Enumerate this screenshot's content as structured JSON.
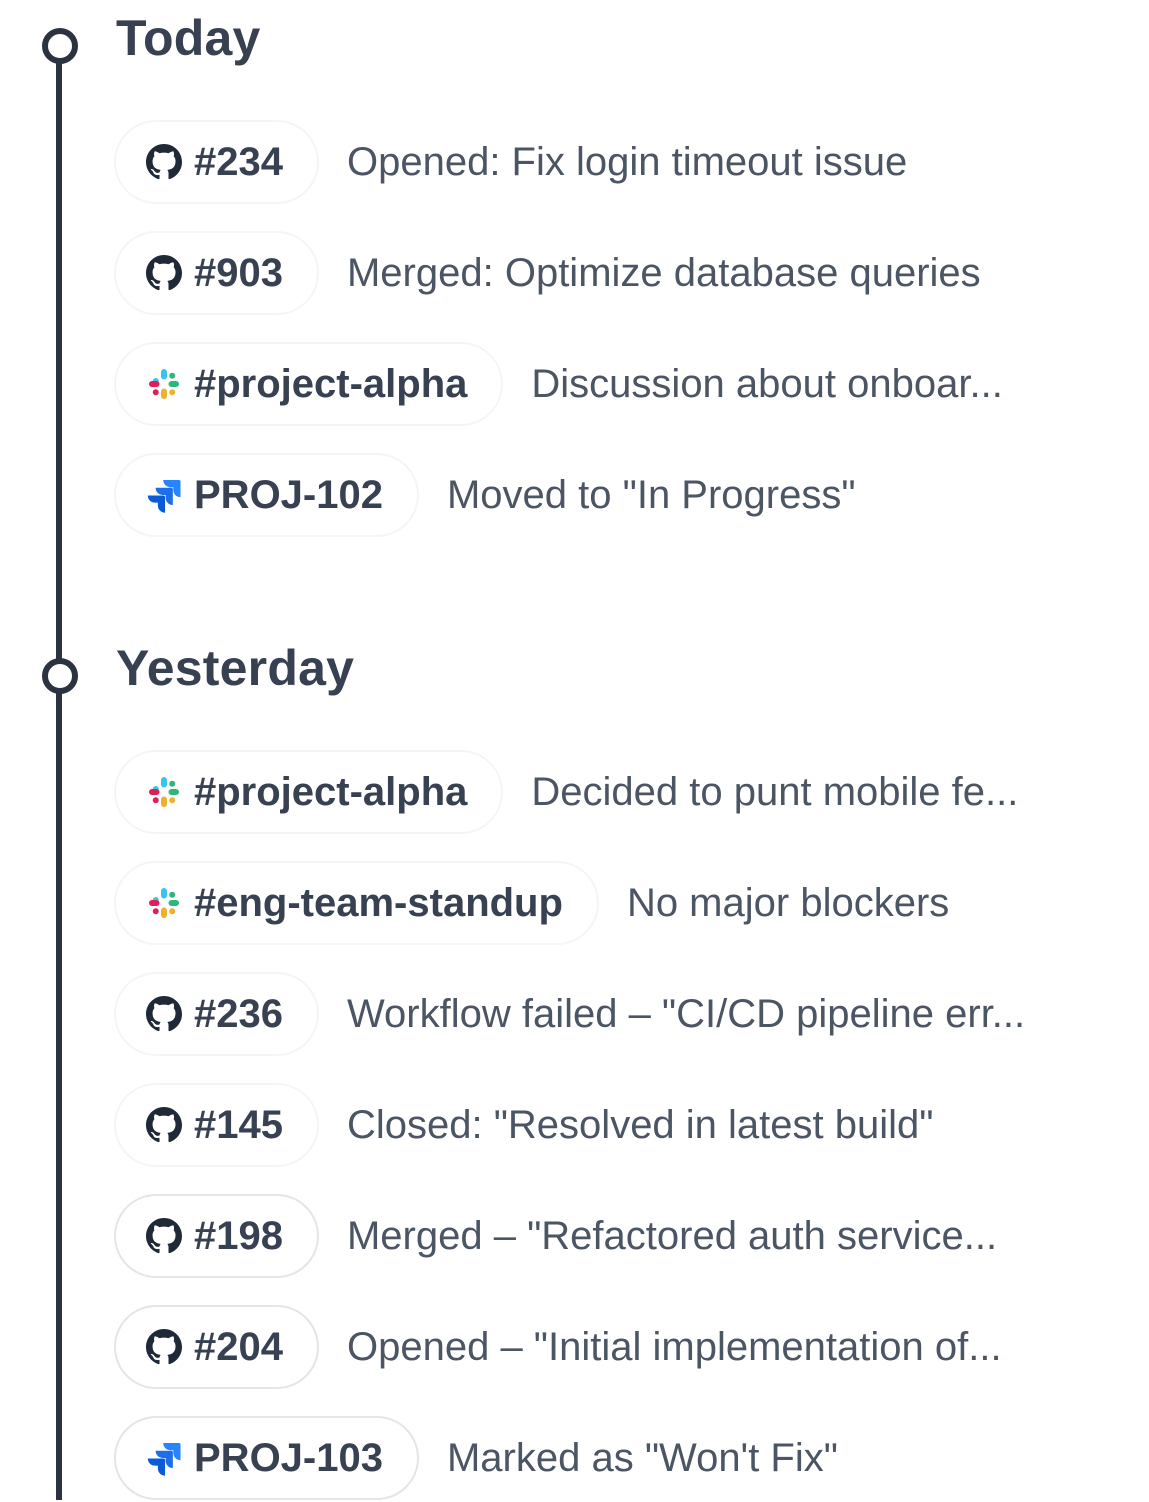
{
  "sections": [
    {
      "title": "Today",
      "items": [
        {
          "source": "github-icon",
          "ref": "#234",
          "text": "Opened: Fix login timeout issue"
        },
        {
          "source": "github-icon",
          "ref": "#903",
          "text": "Merged: Optimize database queries"
        },
        {
          "source": "slack-icon",
          "ref": "#project-alpha",
          "text": "Discussion about onboar..."
        },
        {
          "source": "jira-icon",
          "ref": "PROJ-102",
          "text": "Moved to \"In Progress\""
        }
      ]
    },
    {
      "title": "Yesterday",
      "items": [
        {
          "source": "slack-icon",
          "ref": "#project-alpha",
          "text": "Decided to punt mobile fe..."
        },
        {
          "source": "slack-icon",
          "ref": "#eng-team-standup",
          "text": "No major blockers"
        },
        {
          "source": "github-icon",
          "ref": "#236",
          "text": "Workflow failed – \"CI/CD pipeline err..."
        },
        {
          "source": "github-icon",
          "ref": "#145",
          "text": "Closed: \"Resolved in latest build\""
        },
        {
          "source": "github-icon",
          "ref": "#198",
          "text": "Merged – \"Refactored auth service..."
        },
        {
          "source": "github-icon",
          "ref": "#204",
          "text": "Opened – \"Initial implementation of..."
        },
        {
          "source": "jira-icon",
          "ref": "PROJ-103",
          "text": "Marked as \"Won't Fix\""
        }
      ]
    }
  ],
  "colors": {
    "timeline": "#2b3340",
    "heading": "#374151",
    "description": "#4b5563",
    "jira_blue": "#2684ff",
    "slack": [
      "#e01e5a",
      "#36c5f0",
      "#2eb67d",
      "#ecb22e"
    ]
  }
}
